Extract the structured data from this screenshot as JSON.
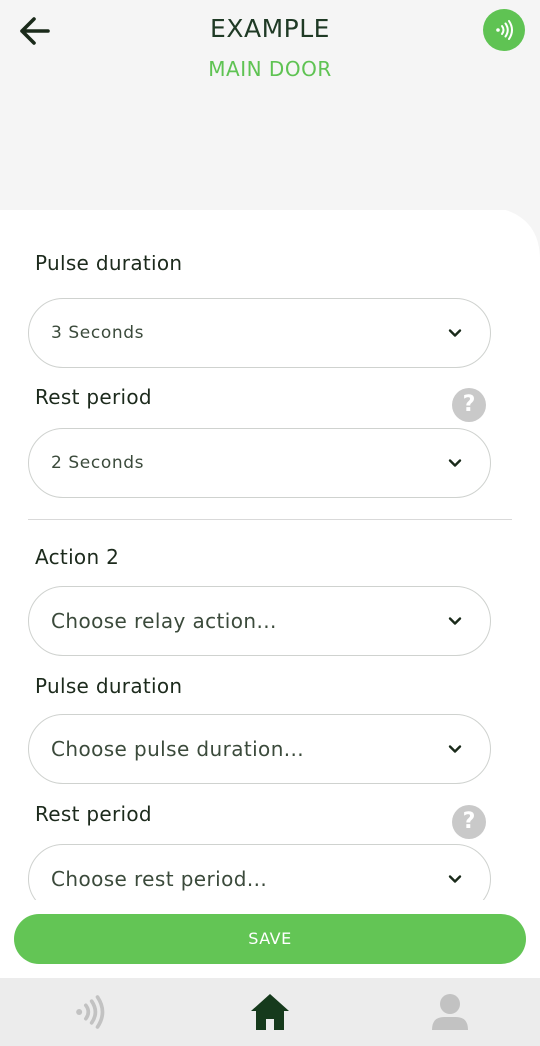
{
  "header": {
    "title": "EXAMPLE",
    "subtitle": "MAIN DOOR",
    "back_icon": "arrow-left-icon",
    "nfc_icon": "nfc-signal-icon"
  },
  "form": {
    "cut_label": "Pulse duration",
    "action1": {
      "pulse_value": "3 Seconds",
      "rest_label": "Rest period",
      "rest_value": "2 Seconds"
    },
    "action2": {
      "heading": "Action 2",
      "relay_placeholder": "Choose relay action...",
      "pulse_label": "Pulse duration",
      "pulse_placeholder": "Choose pulse duration...",
      "rest_label": "Rest period",
      "rest_placeholder": "Choose rest period..."
    },
    "help_glyph": "?"
  },
  "save_label": "SAVE",
  "tabs": [
    {
      "icon": "nfc-icon",
      "active": false
    },
    {
      "icon": "home-icon",
      "active": true
    },
    {
      "icon": "user-icon",
      "active": false
    }
  ],
  "colors": {
    "accent": "#5fc353",
    "dark": "#1f3a25",
    "header_bg": "#f5f5f5",
    "tabbar_bg": "#ececec",
    "inactive_icon": "#c2c2c2"
  }
}
